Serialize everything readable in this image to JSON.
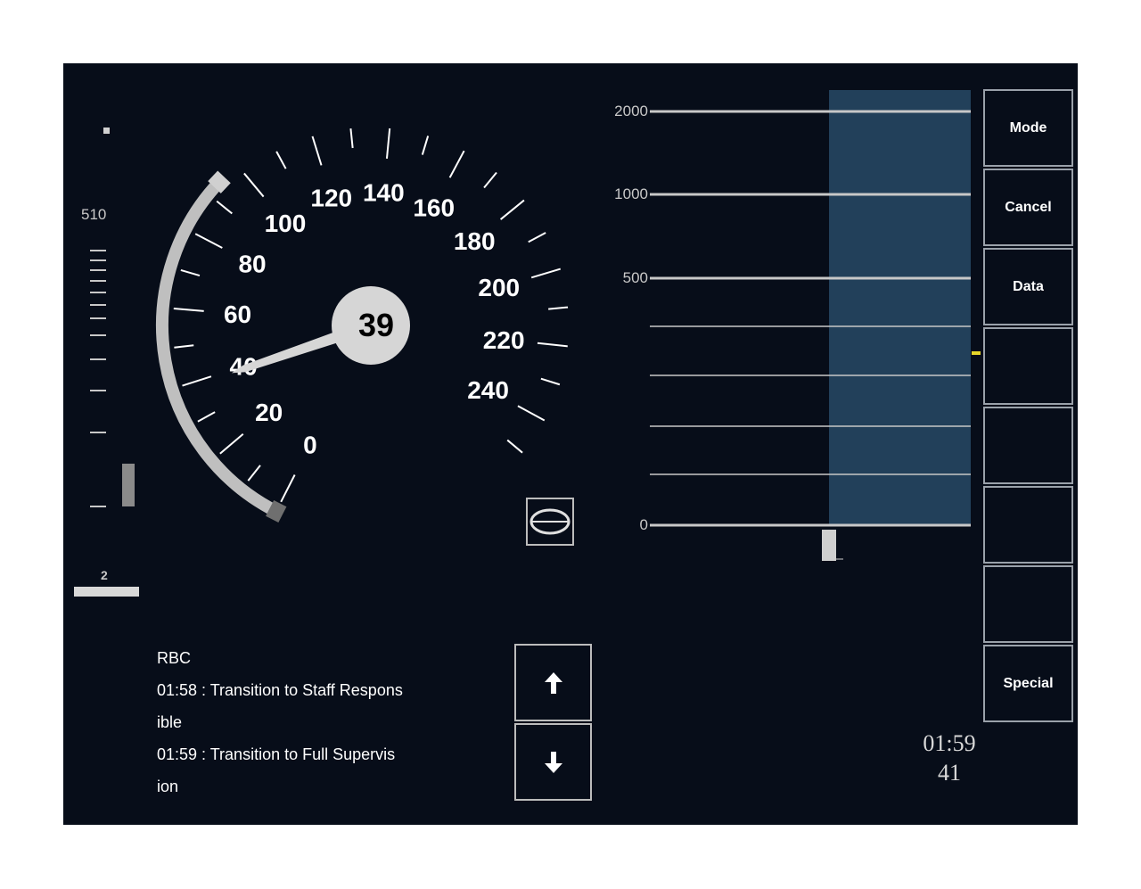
{
  "distance_panel": {
    "target_distance_label": "510",
    "gradient_label": "2"
  },
  "speedometer": {
    "current_speed": 39,
    "max_speed": 250,
    "ticks": [
      {
        "label": "0",
        "value": 0
      },
      {
        "label": "20",
        "value": 20
      },
      {
        "label": "40",
        "value": 40
      },
      {
        "label": "60",
        "value": 60
      },
      {
        "label": "80",
        "value": 80
      },
      {
        "label": "100",
        "value": 100
      },
      {
        "label": "120",
        "value": 120
      },
      {
        "label": "140",
        "value": 140
      },
      {
        "label": "160",
        "value": 160
      },
      {
        "label": "180",
        "value": 180
      },
      {
        "label": "200",
        "value": 200
      },
      {
        "label": "220",
        "value": 220
      },
      {
        "label": "240",
        "value": 240
      }
    ],
    "colors": {
      "gauge": "#bfbfbf",
      "needle": "#d6d6d6",
      "text": "#ffffff"
    }
  },
  "planning_area": {
    "scale_labels": {
      "top": "2000",
      "upper": "1000",
      "middle": "500",
      "bottom": "0"
    },
    "colors": {
      "speed_band": "#22405a",
      "indicator": "#e6d62a"
    }
  },
  "side_buttons": {
    "mode": "Mode",
    "cancel": "Cancel",
    "data": "Data",
    "empty1": "",
    "empty2": "",
    "empty3": "",
    "empty4": "",
    "special": "Special"
  },
  "messages": {
    "line1": "RBC",
    "line2": "01:58  : Transition to Staff Respons",
    "line3": "ible",
    "line4": "01:59  : Transition to Full Supervis",
    "line5": "ion"
  },
  "clock": {
    "time": "01:59",
    "seconds": "41"
  },
  "icons": {
    "mode_icon": "full-supervision-icon",
    "scroll_up": "arrow-up-icon",
    "scroll_down": "arrow-down-icon"
  }
}
